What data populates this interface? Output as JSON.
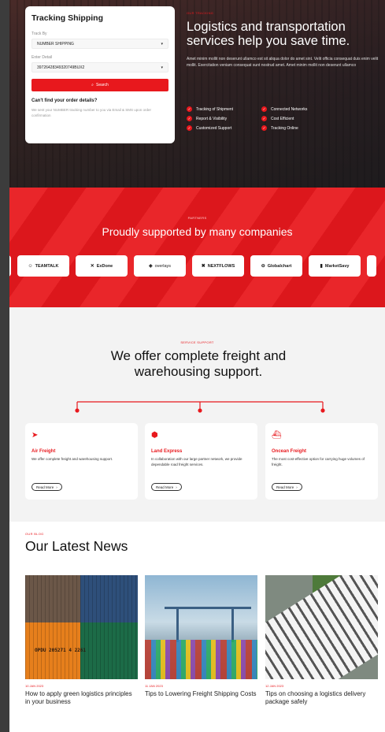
{
  "tracking": {
    "title": "Tracking Shipping",
    "track_by_label": "Track By",
    "track_by_value": "NUMBER SHIPPING",
    "detail_label": "Enter Detail",
    "detail_value": "39726428349320749BUX2",
    "search_label": "Search",
    "help_title": "Can't find your order details?",
    "help_text": "We sent your NUMBER tracking number to you via Email & SMS upon order confirmation"
  },
  "hero": {
    "eyebrow": "OUR TRACKING",
    "title": "Logistics and transportation services help you save time.",
    "description": "Amet minim mollit non deserunt ullamco est sit aliqua dolor do amet sint. Velit officia consequat duis enim velit mollit. Exercitation veniam consequat sunt nostrud amet. Amet minim mollit non deserunt ullamco",
    "features": [
      "Tracking of Shipment",
      "Connected Networks",
      "Report & Visibility",
      "Cost Efficient",
      "Customized Support",
      "Tracking Online"
    ]
  },
  "partners": {
    "eyebrow": "PARTNERS",
    "title": "Proudly supported by many companies",
    "logos": [
      "TEAMTALK",
      "ExDone",
      "overlays",
      "NEXTFLOWS",
      "Globalchart",
      "MarketSavy"
    ]
  },
  "services": {
    "eyebrow": "SERVICE SUPPORT",
    "title": "We offer complete freight and warehousing support.",
    "items": [
      {
        "title": "Air Freight",
        "text": "We offer complete freight and warehousing support.",
        "cta": "Read More"
      },
      {
        "title": "Land Express",
        "text": "In collaboration with our large partner network, we provide dependable road freight services.",
        "cta": "Read More"
      },
      {
        "title": "Oncean Freight",
        "text": "The most cost-effective option for carrying huge volumes of freight.",
        "cta": "Read More"
      }
    ]
  },
  "news": {
    "eyebrow": "OUR BLOG",
    "title": "Our Latest News",
    "posts": [
      {
        "date": "10 JAN 2023",
        "title": "How to apply green logistics principles in your business"
      },
      {
        "date": "11 JAN 2023",
        "title": "Tips to Lowering Freight Shipping Costs"
      },
      {
        "date": "12 JAN 2023",
        "title": "Tips on choosing a logistics delivery package safely"
      }
    ],
    "container_text": "OPDU 205271 4 2261"
  },
  "colors": {
    "accent": "#e8181d",
    "dark": "#1a1a1a"
  }
}
